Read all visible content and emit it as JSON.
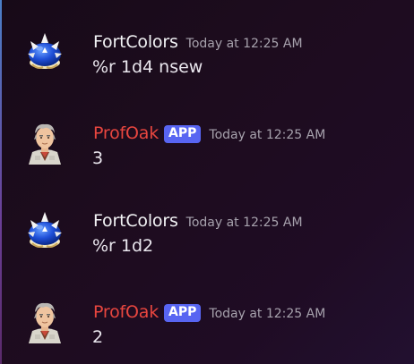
{
  "messages": [
    {
      "author": "FortColors",
      "author_color": "#f2f3f5",
      "avatar": "blue-shell-icon",
      "badge": "",
      "timestamp": "Today at 12:25 AM",
      "content": "%r 1d4 nsew"
    },
    {
      "author": "ProfOak",
      "author_color": "#e8463f",
      "avatar": "prof-oak-icon",
      "badge": "APP",
      "timestamp": "Today at 12:25 AM",
      "content": "3"
    },
    {
      "author": "FortColors",
      "author_color": "#f2f3f5",
      "avatar": "blue-shell-icon",
      "badge": "",
      "timestamp": "Today at 12:25 AM",
      "content": "%r 1d2"
    },
    {
      "author": "ProfOak",
      "author_color": "#e8463f",
      "avatar": "prof-oak-icon",
      "badge": "APP",
      "timestamp": "Today at 12:25 AM",
      "content": "2"
    }
  ],
  "colors": {
    "badge_bg": "#5865f2",
    "timestamp": "#a7a2ad",
    "content": "#eae7ee"
  }
}
